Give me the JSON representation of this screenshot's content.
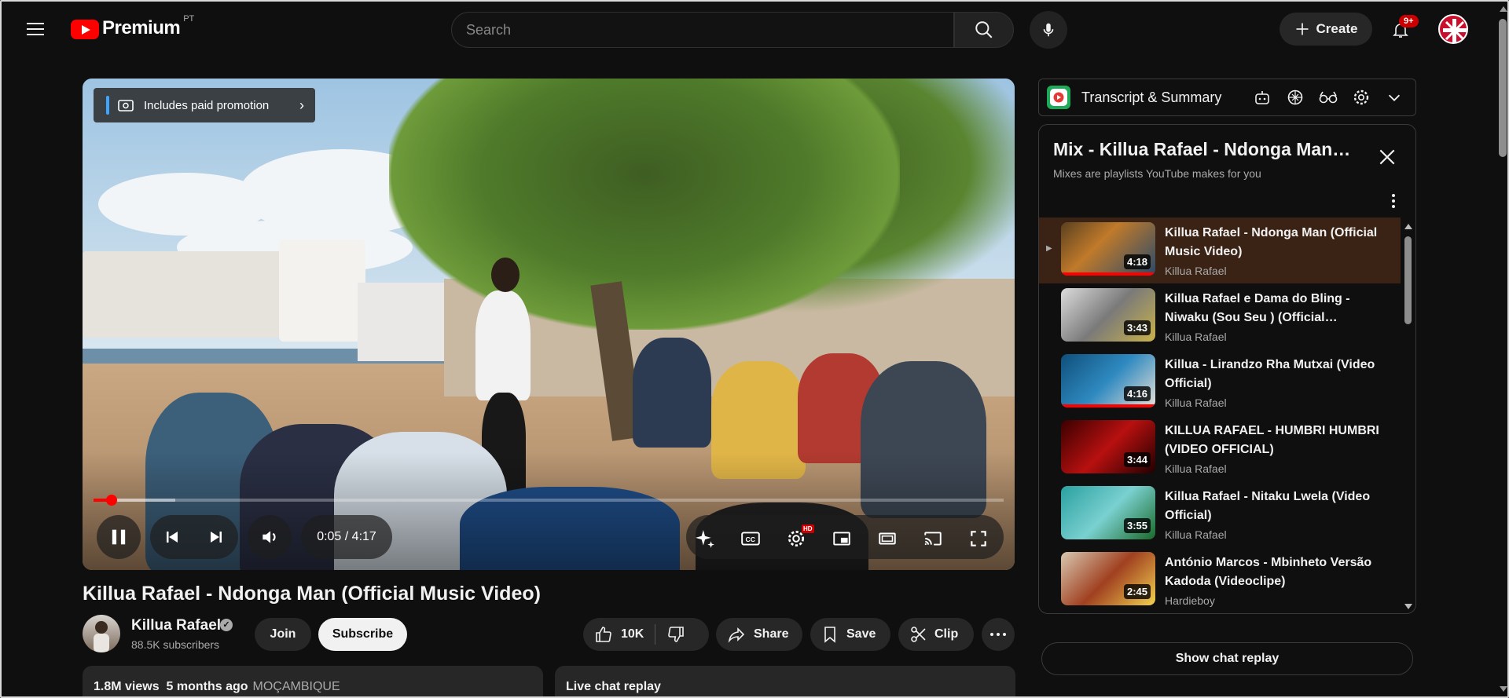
{
  "topbar": {
    "logo_text": "Premium",
    "logo_country": "PT",
    "search_placeholder": "Search",
    "create_label": "Create",
    "notifications_badge": "9+"
  },
  "player": {
    "paid_promotion": "Includes paid promotion",
    "current_time": "0:05",
    "separator": " / ",
    "duration": "4:17",
    "progress_played_fraction": 0.02,
    "progress_buffered_fraction": 0.09,
    "settings_badge": "HD"
  },
  "video": {
    "title": "Killua Rafael - Ndonga Man (Official Music Video)",
    "channel": "Killua Rafael",
    "subscribers": "88.5K subscribers",
    "join_label": "Join",
    "subscribe_label": "Subscribe",
    "likes": "10K",
    "share_label": "Share",
    "save_label": "Save",
    "clip_label": "Clip",
    "views": "1.8M views",
    "age": "5 months ago",
    "tag": "MOÇAMBIQUE",
    "live_chat_label": "Live chat replay"
  },
  "extension": {
    "title": "Transcript & Summary"
  },
  "mix": {
    "title": "Mix - Killua Rafael - Ndonga Man (Official Music Video)",
    "subtitle": "Mixes are playlists YouTube makes for you",
    "items": [
      {
        "title": "Killua Rafael - Ndonga Man (Official Music Video)",
        "channel": "Killua Rafael",
        "duration": "4:18",
        "active": true,
        "watched": 1.0
      },
      {
        "title": "Killua Rafael e Dama do Bling - Niwaku (Sou Seu ) (Official…",
        "channel": "Killua Rafael",
        "duration": "3:43",
        "active": false,
        "watched": 0
      },
      {
        "title": "Killua - Lirandzo Rha Mutxai (Video Official)",
        "channel": "Killua Rafael",
        "duration": "4:16",
        "active": false,
        "watched": 1.0
      },
      {
        "title": "KILLUA RAFAEL - HUMBRI HUMBRI (VIDEO OFFICIAL)",
        "channel": "Killua Rafael",
        "duration": "3:44",
        "active": false,
        "watched": 0
      },
      {
        "title": "Killua Rafael - Nitaku Lwela (Video Official)",
        "channel": "Killua Rafael",
        "duration": "3:55",
        "active": false,
        "watched": 0
      },
      {
        "title": "António Marcos - Mbinheto Versão Kadoda (Videoclipe)",
        "channel": "Hardieboy",
        "duration": "2:45",
        "active": false,
        "watched": 0
      }
    ],
    "show_chat_label": "Show chat replay"
  }
}
